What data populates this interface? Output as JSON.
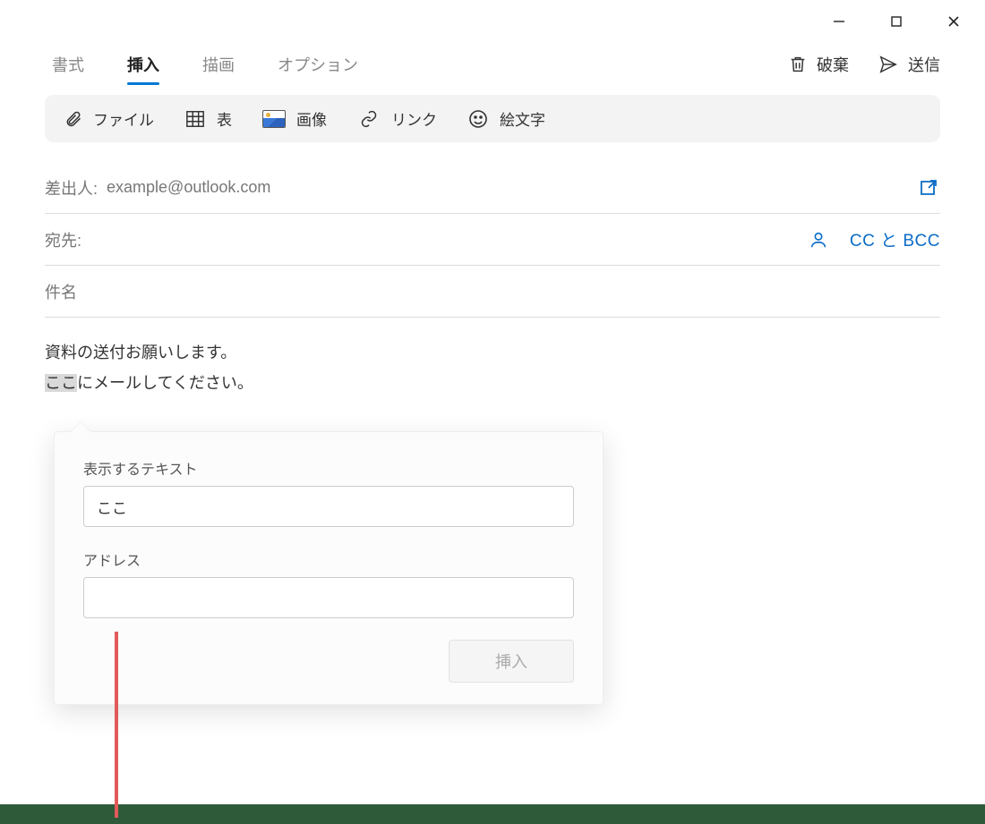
{
  "tabs": {
    "format": "書式",
    "insert": "挿入",
    "draw": "描画",
    "options": "オプション"
  },
  "actions": {
    "discard": "破棄",
    "send": "送信"
  },
  "ribbon": {
    "file": "ファイル",
    "table": "表",
    "image": "画像",
    "link": "リンク",
    "emoji": "絵文字"
  },
  "from": {
    "label": "差出人:",
    "value": "example@outlook.com"
  },
  "to": {
    "label": "宛先:",
    "ccbcc": "CC と BCC"
  },
  "subject": {
    "placeholder": "件名"
  },
  "body": {
    "line1": "資料の送付お願いします。",
    "highlight": "ここ",
    "line2_rest": "にメールしてください。"
  },
  "popup": {
    "text_label": "表示するテキスト",
    "text_value": "ここ",
    "address_label": "アドレス",
    "address_value": "",
    "insert": "挿入"
  }
}
